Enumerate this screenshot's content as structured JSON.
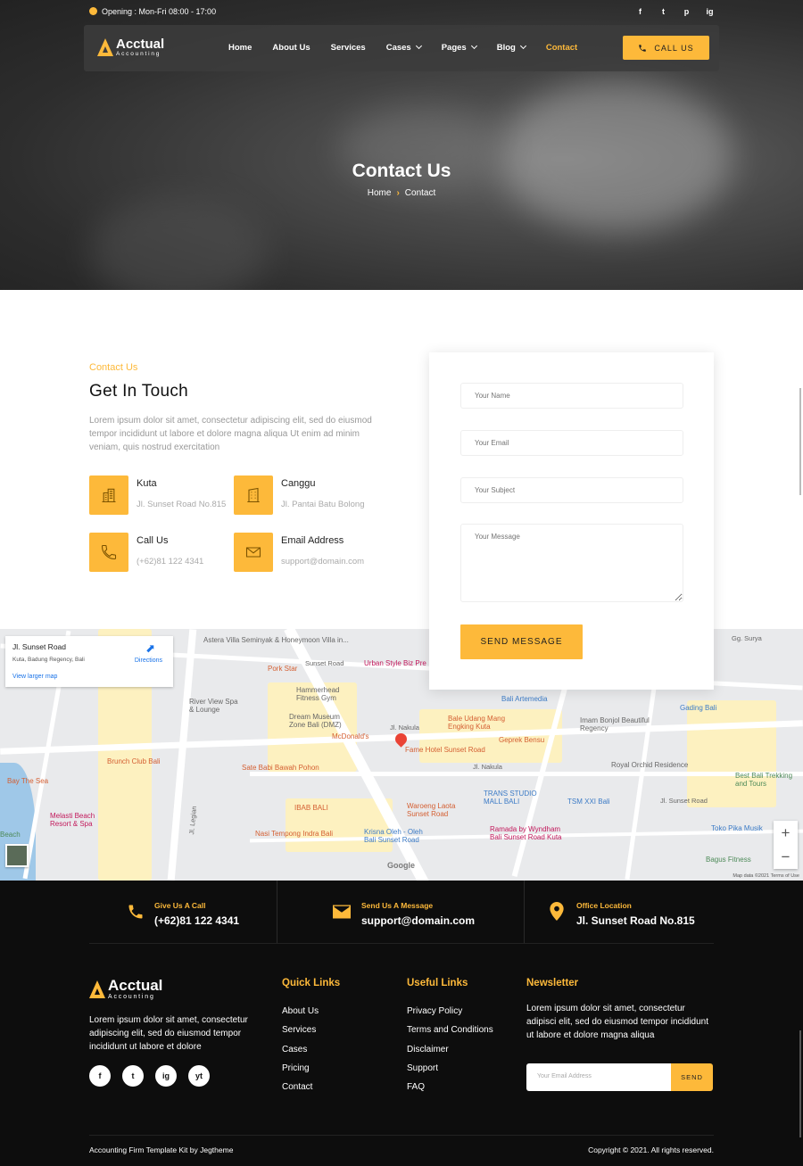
{
  "colors": {
    "accent": "#FDB93A",
    "footer_bg": "#0d0d0d"
  },
  "topbar": {
    "opening": "Opening : Mon-Fri 08:00 - 17:00",
    "social": [
      "f",
      "t",
      "p",
      "ig"
    ]
  },
  "brand": {
    "name": "Acctual",
    "sub": "Accounting"
  },
  "nav": {
    "items": [
      "Home",
      "About Us",
      "Services",
      "Cases",
      "Pages",
      "Blog",
      "Contact"
    ],
    "active": "Contact",
    "call": "CALL US"
  },
  "hero": {
    "title": "Contact Us",
    "crumb_home": "Home",
    "crumb_current": "Contact"
  },
  "contact": {
    "label": "Contact Us",
    "title": "Get In Touch",
    "desc": "Lorem ipsum dolor sit amet, consectetur adipiscing elit, sed do eiusmod tempor incididunt ut labore et dolore magna aliqua Ut enim ad minim veniam, quis nostrud exercitation",
    "items": [
      {
        "title": "Kuta",
        "sub": "Jl. Sunset Road No.815",
        "icon": "building-icon"
      },
      {
        "title": "Canggu",
        "sub": "Jl. Pantai Batu Bolong",
        "icon": "office-icon"
      },
      {
        "title": "Call Us",
        "sub": "(+62)81 122 4341",
        "icon": "phone-icon"
      },
      {
        "title": "Email Address",
        "sub": "support@domain.com",
        "icon": "envelope-icon"
      }
    ]
  },
  "form": {
    "name": "Your Name",
    "email": "Your Email",
    "subject": "Your Subject",
    "message": "Your Message",
    "send": "SEND MESSAGE"
  },
  "map": {
    "card_title": "Jl. Sunset Road",
    "card_sub": "Kuta, Badung Regency, Bali",
    "card_link": "View larger map",
    "card_dir": "Directions",
    "attribution": "Map data ©2021   Terms of Use",
    "google": "Google",
    "labels": [
      "Astera Villa Seminyak & Honeymoon Villa in...",
      "Sunset Road",
      "Urban Style Biz Pre",
      "Pork Star",
      "Hammerhead Fitness Gym",
      "River View Spa & Lounge",
      "Dream Museum Zone Bali (DMZ)",
      "McDonald's",
      "Jl. Nakula",
      "Bale Udang Mang Engking Kuta",
      "Geprek Bensu",
      "Bali Artemedia",
      "Imam Bonjol Beautiful Regency",
      "Gading Bali",
      "Fame Hotel Sunset Road",
      "Brunch Club Bali",
      "Sate Babi Bawah Pohon",
      "Royal Orchid Residence",
      "Best Bali Trekking and Tours",
      "TRANS STUDIO MALL BALI",
      "TSM XXI Bali",
      "Waroeng Laota Sunset Road",
      "IBAB BALI",
      "Melasti Beach Resort & Spa",
      "Nasi Tempong Indra Bali",
      "Krisna Oleh - Oleh Bali Sunset Road",
      "Ramada by Wyndham Bali Sunset Road Kuta",
      "Toko Pika Musik",
      "Bagus Fitness",
      "Jl. Legian",
      "Bay The Sea",
      "Beach",
      "Jl. Sunset Road",
      "Jl. Nakula",
      "Gg. Surya"
    ]
  },
  "footer": {
    "call_label": "Give Us A Call",
    "call_value": "(+62)81 122 4341",
    "msg_label": "Send Us A Message",
    "msg_value": "support@domain.com",
    "loc_label": "Office Location",
    "loc_value": "Jl. Sunset Road No.815",
    "about": "Lorem ipsum dolor sit amet, consectetur adipiscing elit, sed do eiusmod tempor incididunt ut labore et dolore",
    "quick_title": "Quick Links",
    "quick": [
      "About Us",
      "Services",
      "Cases",
      "Pricing",
      "Contact"
    ],
    "useful_title": "Useful Links",
    "useful": [
      "Privacy Policy",
      "Terms and Conditions",
      "Disclaimer",
      "Support",
      "FAQ"
    ],
    "news_title": "Newsletter",
    "news_text": "Lorem ipsum dolor sit amet, consectetur adipisci elit, sed do eiusmod tempor incididunt ut labore et dolore magna aliqua",
    "email_placeholder": "Your Email Address",
    "send": "SEND",
    "credit": "Accounting Firm Template Kit by Jegtheme",
    "copyright": "Copyright © 2021. All rights reserved.",
    "social": [
      "f",
      "t",
      "ig",
      "yt"
    ]
  }
}
